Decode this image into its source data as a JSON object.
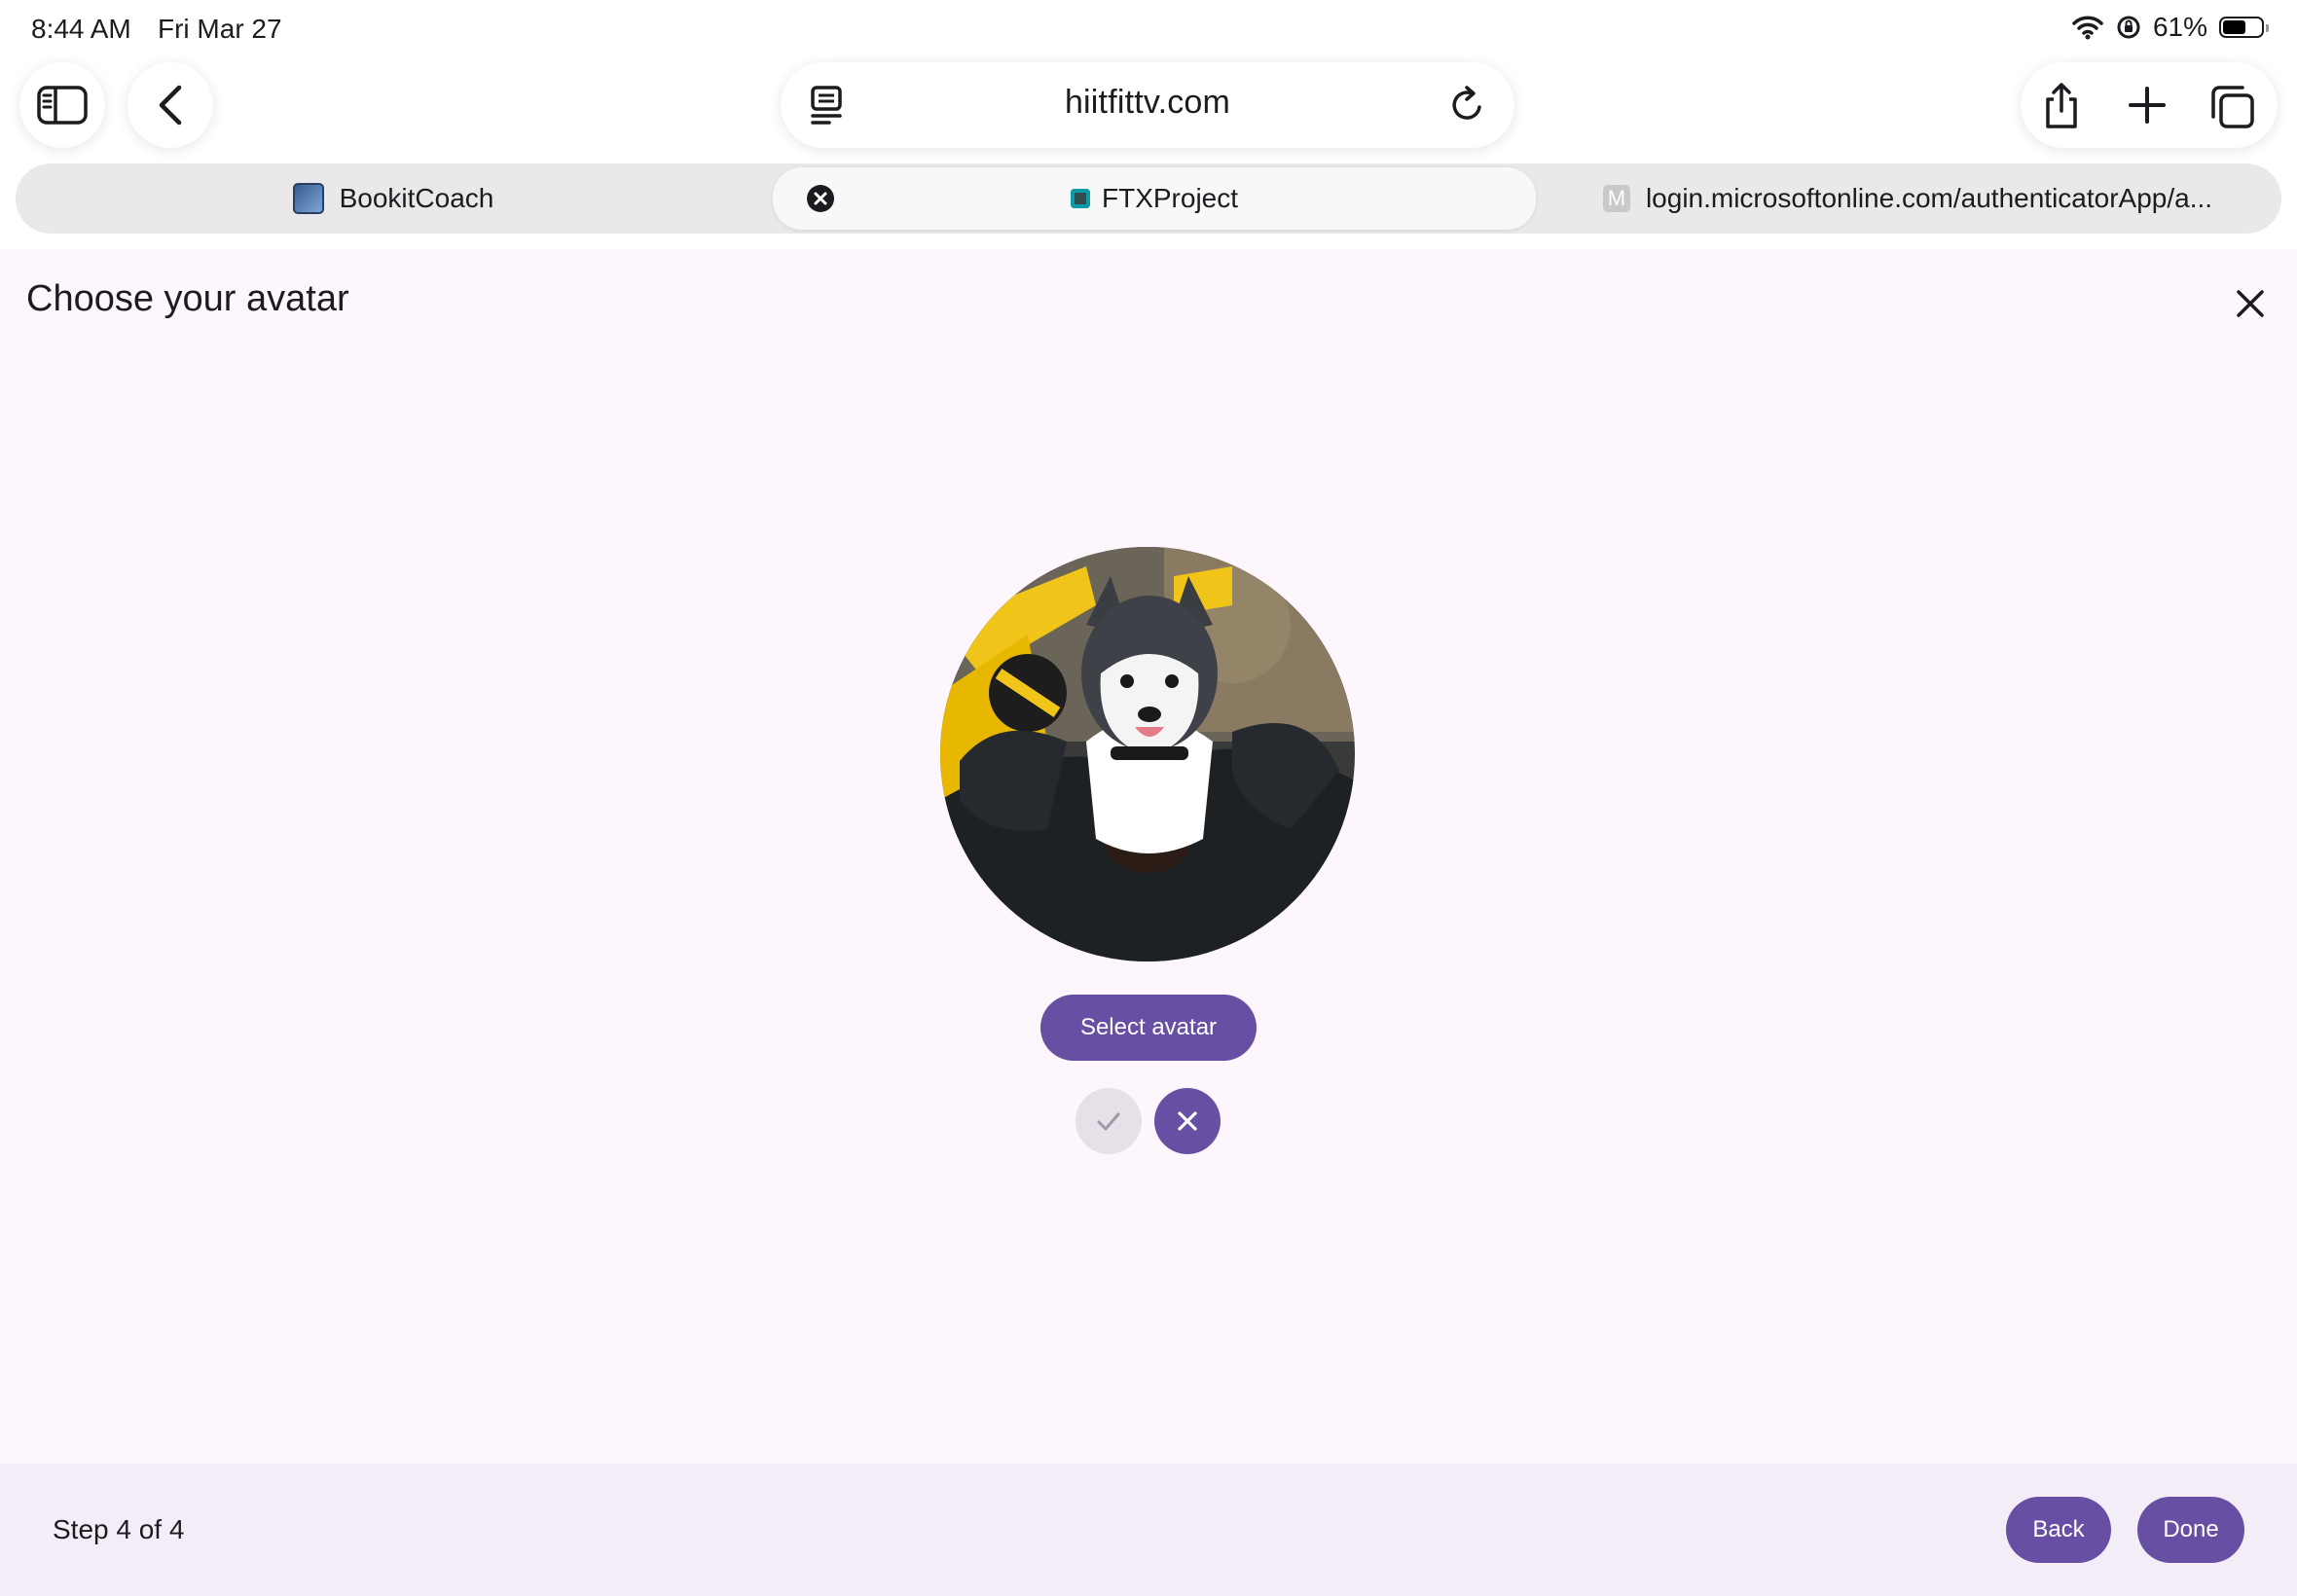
{
  "status_bar": {
    "time": "8:44 AM",
    "date": "Fri Mar 27",
    "battery_text": "61%",
    "battery_level": 0.61
  },
  "browser": {
    "url": "hiitfittv.com",
    "icons": {
      "sidebar": "sidebar-icon",
      "back": "chevron-left-icon",
      "reader": "reader-icon",
      "reload": "reload-icon",
      "share": "share-icon",
      "new_tab": "plus-icon",
      "tabs": "tabs-overview-icon"
    },
    "tabs": [
      {
        "label": "BookitCoach",
        "active": false
      },
      {
        "label": "FTXProject",
        "active": true
      },
      {
        "label": "login.microsoftonline.com/authenticatorApp/a...",
        "active": false,
        "favicon_letter": "M"
      }
    ]
  },
  "dialog": {
    "title": "Choose your avatar",
    "select_button": "Select avatar",
    "confirm_icon": "check-icon",
    "cancel_icon": "close-icon"
  },
  "footer": {
    "step_text": "Step 4 of 4",
    "back_label": "Back",
    "done_label": "Done"
  },
  "colors": {
    "primary": "#6750a4",
    "page_background": "#fdf7fd",
    "footer_background": "#f3edf7",
    "disabled_button": "#e6e0e9"
  }
}
